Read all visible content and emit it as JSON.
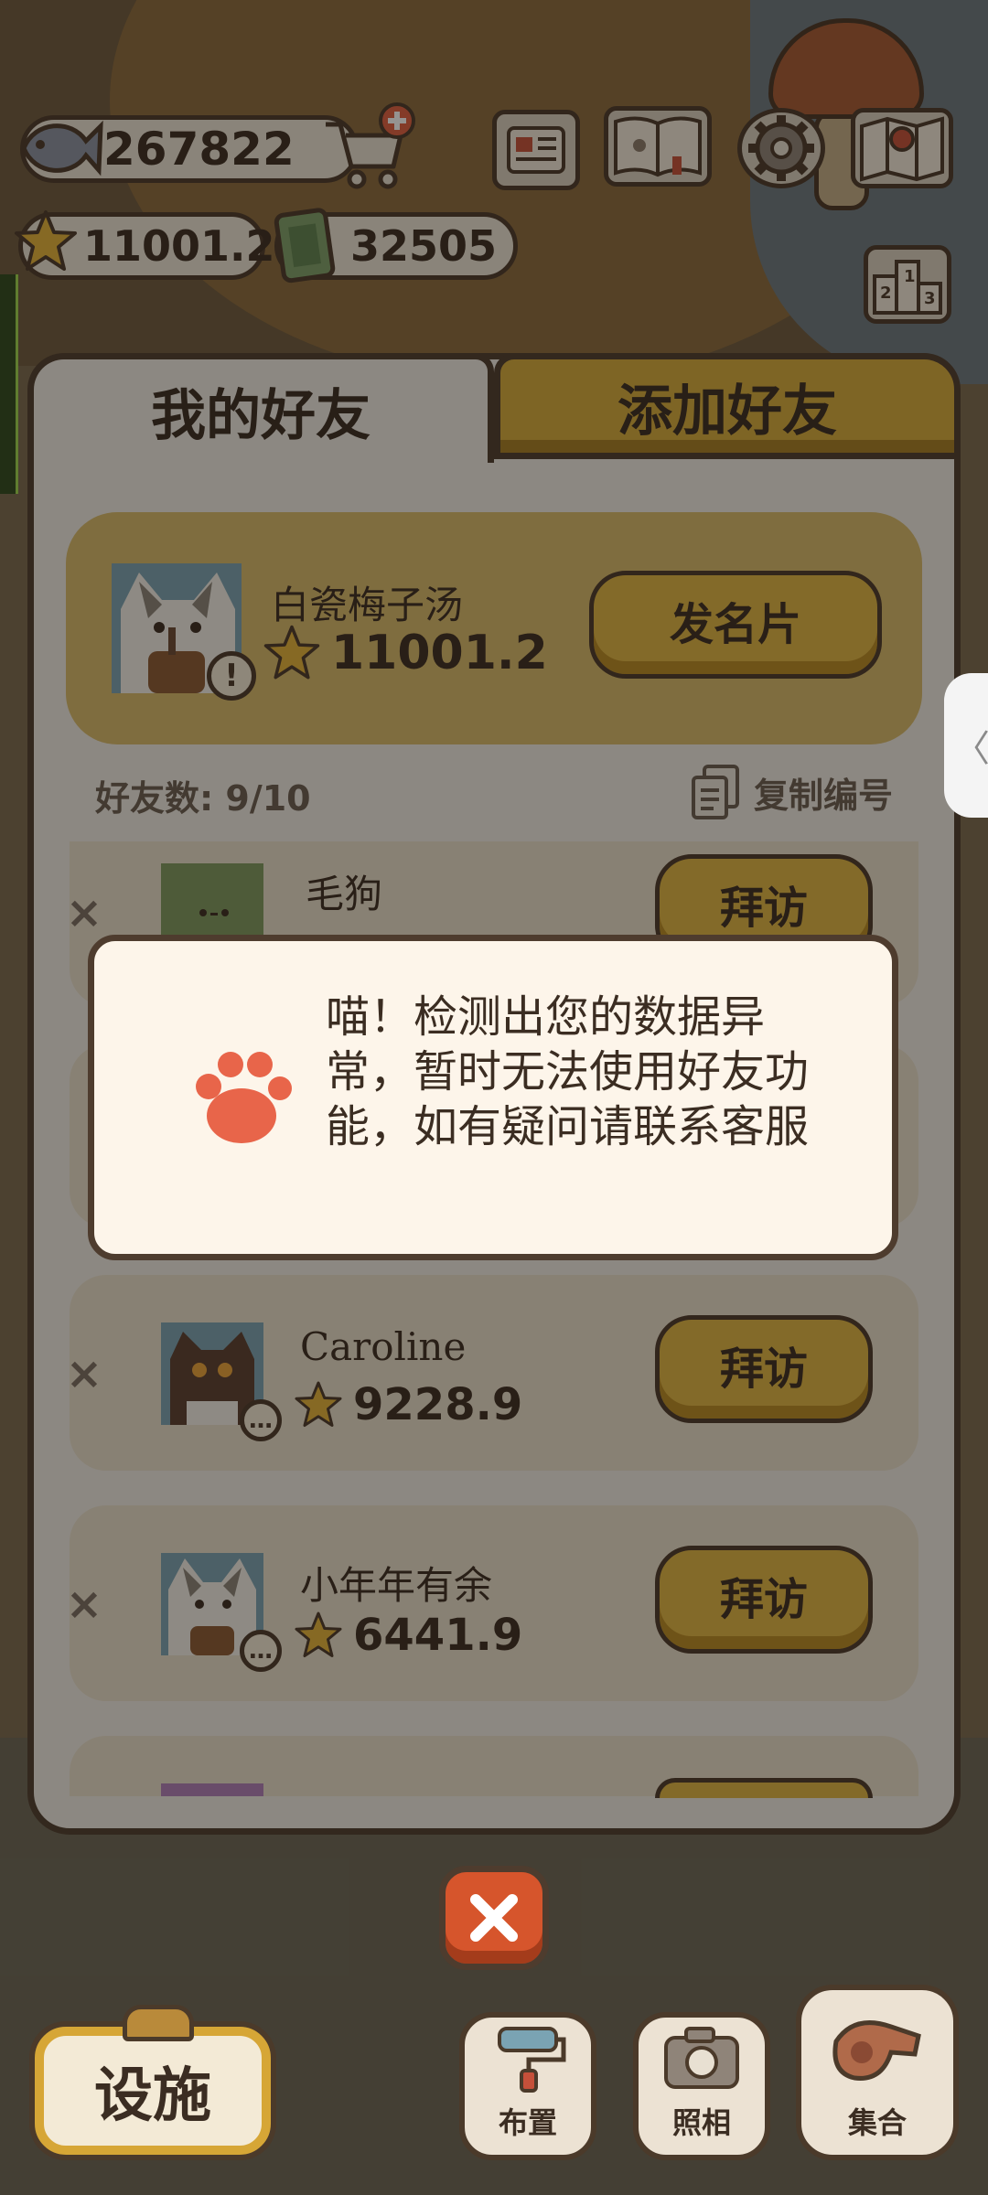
{
  "hud": {
    "fish_count": "267822",
    "star_score": "11001.2",
    "tickets": "32505"
  },
  "tabs": {
    "my_friends": "我的好友",
    "add_friend": "添加好友"
  },
  "me": {
    "name": "白瓷梅子汤",
    "score": "11001.2",
    "card_button": "发名片"
  },
  "friends_count": "好友数: 9/10",
  "copy_id": "复制编号",
  "friends": [
    {
      "name": "毛狗",
      "score": "",
      "visit": "拜访"
    },
    {
      "name": "",
      "score": "",
      "visit": ""
    },
    {
      "name": "Caroline",
      "score": "9228.9",
      "visit": "拜访"
    },
    {
      "name": "小年年有余",
      "score": "6441.9",
      "visit": "拜访"
    }
  ],
  "toast": {
    "message": "喵！检测出您的数据异常，暂时无法使用好友功能，如有疑问请联系客服"
  },
  "bottom": {
    "facility": "设施",
    "layout": "布置",
    "photo": "照相",
    "gather": "集合"
  },
  "side_tab": "〈",
  "colors": {
    "gold": "#dfb543",
    "panel": "#efebe4",
    "outline": "#4e3c2e",
    "close_red": "#d6552c"
  }
}
